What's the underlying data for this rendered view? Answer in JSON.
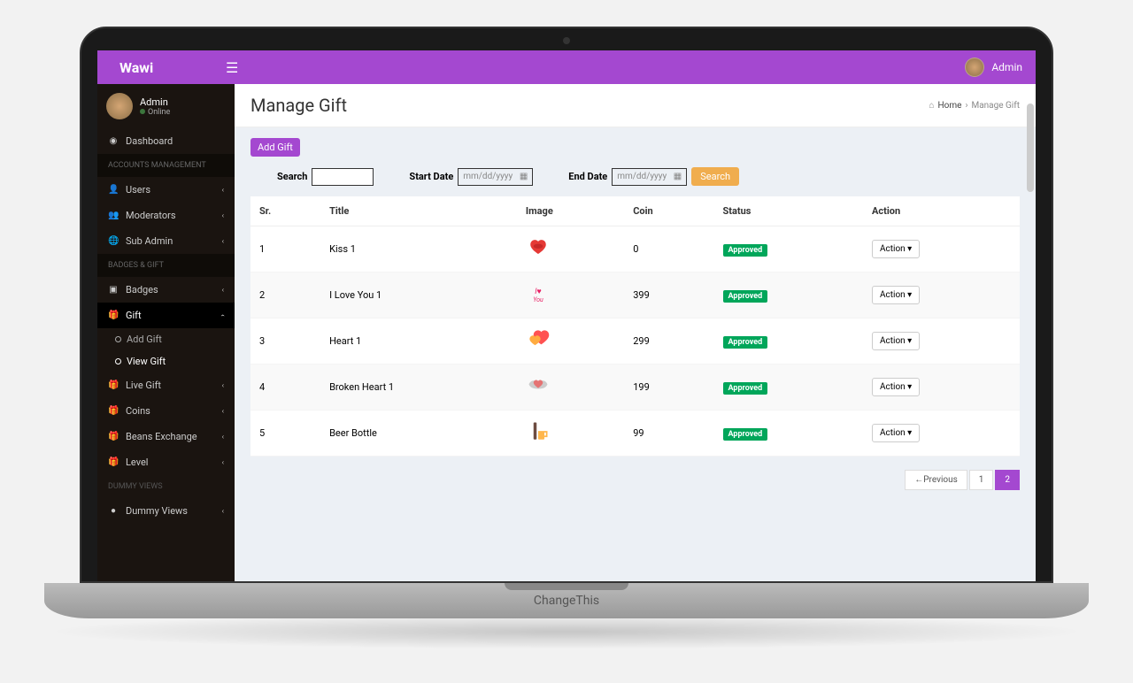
{
  "laptop_base_text": "ChangeThis",
  "topbar": {
    "brand": "Wawi",
    "user": "Admin"
  },
  "sidebar": {
    "user": {
      "name": "Admin",
      "status": "Online"
    },
    "dashboard": "Dashboard",
    "sections": {
      "accounts": "ACCOUNTS MANAGEMENT",
      "badges": "BADGES & GIFT",
      "dummy": "Dummy Views"
    },
    "items": {
      "users": "Users",
      "moderators": "Moderators",
      "sub_admin": "Sub Admin",
      "badges": "Badges",
      "gift": "Gift",
      "add_gift": "Add Gift",
      "view_gift": "View Gift",
      "live_gift": "Live Gift",
      "coins": "Coins",
      "beans": "Beans Exchange",
      "level": "Level",
      "dummy_views": "Dummy Views"
    }
  },
  "page": {
    "title": "Manage Gift",
    "breadcrumb_home": "Home",
    "breadcrumb_current": "Manage Gift",
    "add_btn": "Add Gift",
    "filters": {
      "search_label": "Search",
      "start_label": "Start Date",
      "end_label": "End Date",
      "date_placeholder": "mm/dd/yyyy",
      "search_btn": "Search"
    },
    "columns": {
      "sr": "Sr.",
      "title": "Title",
      "image": "Image",
      "coin": "Coin",
      "status": "Status",
      "action": "Action"
    },
    "status_approved": "Approved",
    "action_label": "Action",
    "rows": [
      {
        "sr": "1",
        "title": "Kiss 1",
        "icon": "kiss",
        "coin": "0"
      },
      {
        "sr": "2",
        "title": "I Love You 1",
        "icon": "iloveyou",
        "coin": "399"
      },
      {
        "sr": "3",
        "title": "Heart 1",
        "icon": "heart",
        "coin": "299"
      },
      {
        "sr": "4",
        "title": "Broken Heart 1",
        "icon": "broken",
        "coin": "199"
      },
      {
        "sr": "5",
        "title": "Beer Bottle",
        "icon": "beer",
        "coin": "99"
      }
    ],
    "pagination": {
      "prev": "←Previous",
      "p1": "1",
      "p2": "2"
    }
  }
}
